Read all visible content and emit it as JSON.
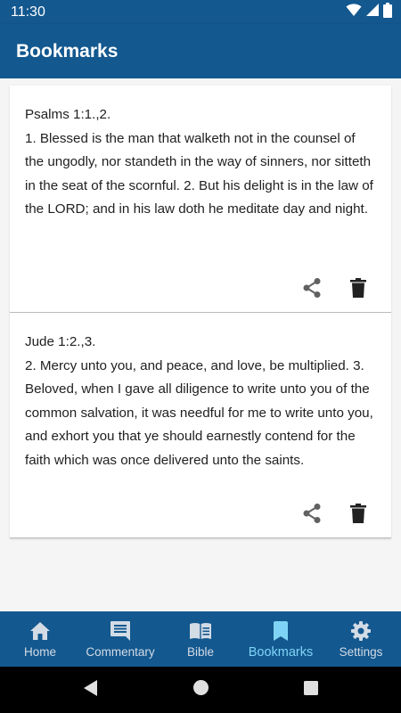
{
  "status_bar": {
    "time": "11:30"
  },
  "app_bar": {
    "title": "Bookmarks"
  },
  "bookmarks": [
    {
      "reference": "Psalms 1:1.,2.",
      "text": "1. Blessed is the man that walketh not in the counsel of the ungodly, nor standeth in the way of sinners, nor sitteth in the seat of the scornful. 2. But his delight is in the law of the LORD; and in his law doth he meditate day and night."
    },
    {
      "reference": "Jude 1:2.,3.",
      "text": "2. Mercy unto you, and peace, and love, be multiplied. 3. Beloved, when I gave all diligence to write unto you of the common salvation, it was needful for me to write unto you, and exhort you that ye should earnestly contend for the faith which was once delivered unto the saints."
    }
  ],
  "bottom_nav": {
    "items": [
      {
        "label": "Home",
        "icon": "home-icon"
      },
      {
        "label": "Commentary",
        "icon": "comment-icon"
      },
      {
        "label": "Bible",
        "icon": "book-icon"
      },
      {
        "label": "Bookmarks",
        "icon": "bookmark-icon",
        "active": true
      },
      {
        "label": "Settings",
        "icon": "gear-icon"
      }
    ]
  },
  "colors": {
    "primary": "#13588f",
    "active_tab": "#7fd4f5",
    "background": "#f5f5f5"
  }
}
